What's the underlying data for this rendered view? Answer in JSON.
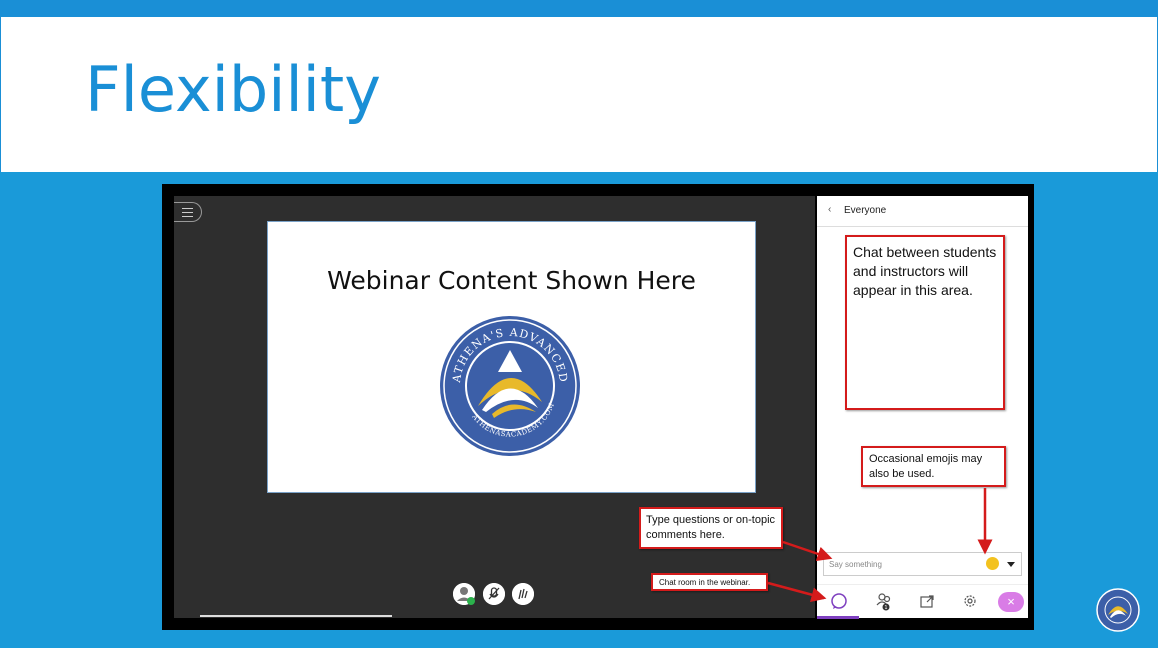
{
  "slide": {
    "title": "Flexibility"
  },
  "stage": {
    "content_heading": "Webinar Content Shown Here",
    "logo_text_top": "ATHENA'S ADVANCED ACADEMY",
    "logo_text_bottom": "ATHENASACADEMY.COM"
  },
  "side_panel": {
    "header_back": "‹",
    "header_label": "Everyone",
    "input_placeholder": "Say something",
    "attendee_count": "1"
  },
  "callouts": {
    "chat_area": "Chat between students and instructors will appear in this area.",
    "emojis": "Occasional emojis may also be used.",
    "type_questions": "Type questions or on-topic comments here.",
    "chat_room": "Chat room in the webinar."
  },
  "colors": {
    "accent_blue": "#1a8fd6",
    "callout_border": "#d41b1b",
    "active_tab": "#7e3fbf",
    "close_button": "#d97ce6",
    "logo_blue": "#3c5fa8",
    "logo_gold": "#e8b92a"
  },
  "icons": [
    "menu-icon",
    "back-chevron-icon",
    "emoji-icon",
    "dropdown-caret-icon",
    "chat-icon",
    "attendees-icon",
    "share-icon",
    "settings-icon",
    "close-icon",
    "avatar-icon",
    "mic-off-icon",
    "hand-raise-icon"
  ]
}
